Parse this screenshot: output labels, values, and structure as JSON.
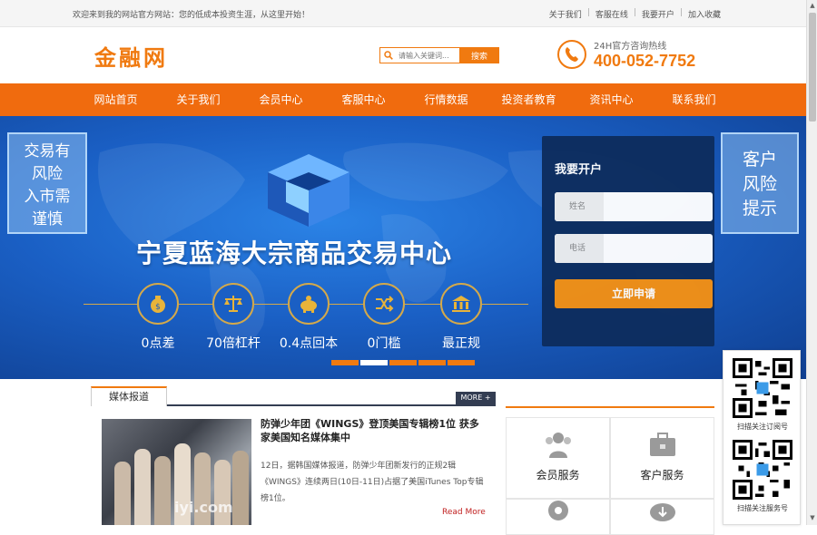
{
  "topbar": {
    "welcome": "欢迎来到我的网站官方网站：您的低成本投资生涯，从这里开始！",
    "links": [
      "关于我们",
      "客服在线",
      "我要开户",
      "加入收藏"
    ]
  },
  "header": {
    "logo": "金融网",
    "search_placeholder": "请输入关键词...",
    "search_button": "搜索",
    "hotline_label": "24H官方咨询热线",
    "hotline_number": "400-052-7752"
  },
  "nav": [
    "网站首页",
    "关于我们",
    "会员中心",
    "客服中心",
    "行情数据",
    "投资者教育",
    "资讯中心",
    "联系我们"
  ],
  "banner": {
    "title": "宁夏蓝海大宗商品交易中心",
    "left_note": [
      "交易有",
      "风险",
      "入市需",
      "谨慎"
    ],
    "right_note": [
      "客户",
      "风险",
      "提示"
    ],
    "features": [
      "0点差",
      "70倍杠杆",
      "0.4点回本",
      "0门槛",
      "最正规"
    ],
    "slide_count": 5,
    "active_slide": 2
  },
  "open_account": {
    "title": "我要开户",
    "name_label": "姓名",
    "phone_label": "电话",
    "submit": "立即申请"
  },
  "news": {
    "tab_label": "媒体报道",
    "more": "MORE +",
    "image_watermark": "iyi.com",
    "title": "防弹少年团《WINGS》登顶美国专辑榜1位 获多家美国知名媒体集中",
    "summary": "12日，据韩国媒体报道，防弹少年团新发行的正规2辑《WINGS》连续两日(10日-11日)占据了美国iTunes Top专辑榜1位。",
    "read_more": "Read More"
  },
  "services": [
    "会员服务",
    "客户服务"
  ],
  "qr": {
    "label1": "扫描关注订阅号",
    "label2": "扫描关注服务号"
  },
  "colors": {
    "accent": "#f07a10",
    "nav": "#f06b0e",
    "banner": "#1a5fc4",
    "panel": "#0d2d5e"
  }
}
